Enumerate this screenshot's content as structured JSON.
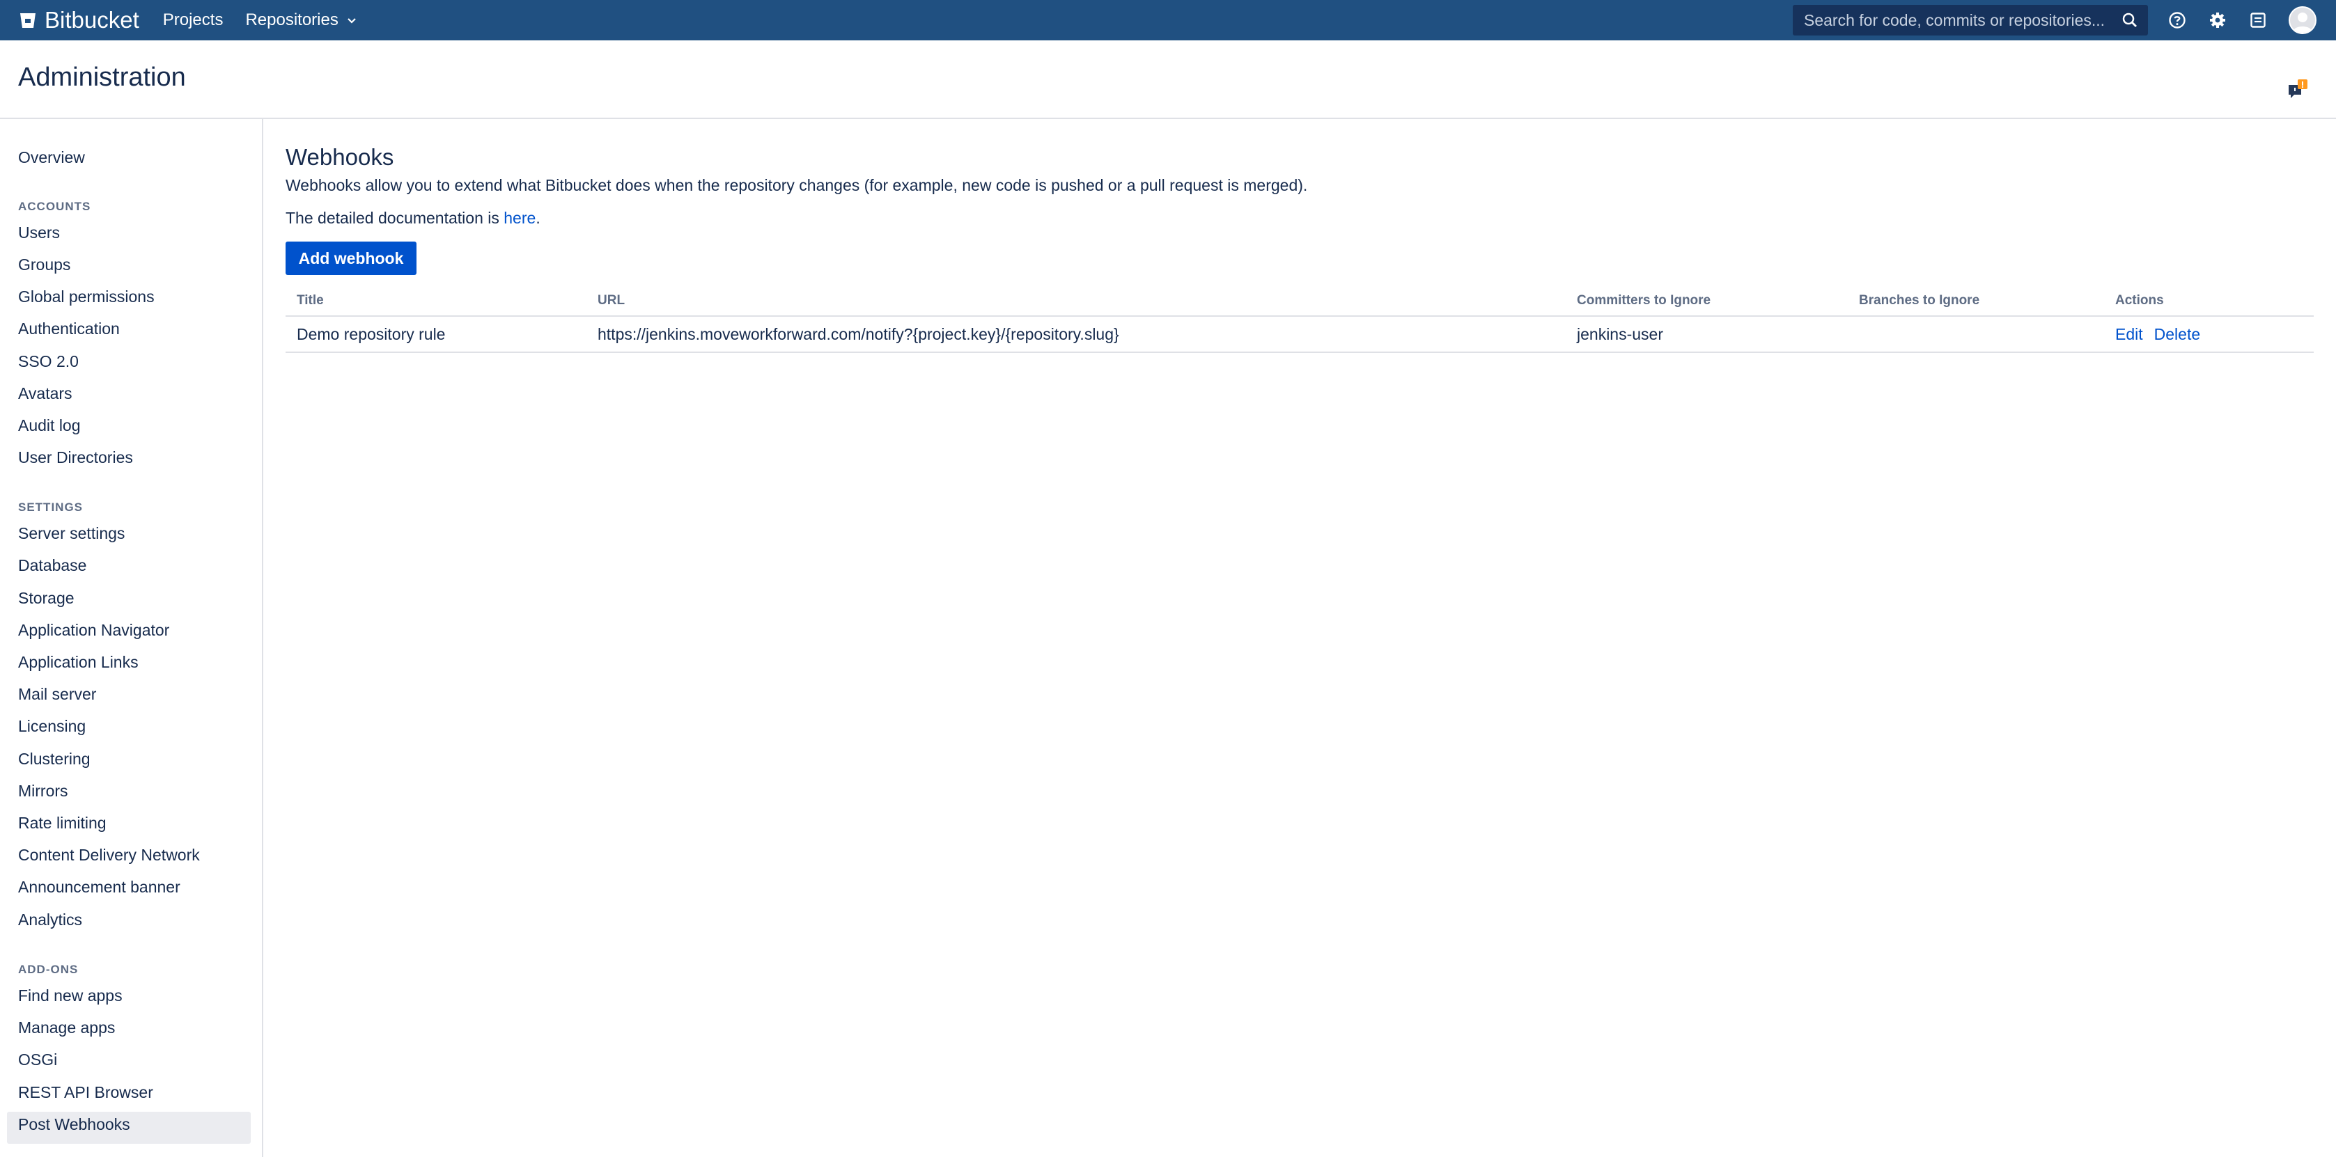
{
  "topnav": {
    "brand": "Bitbucket",
    "projects": "Projects",
    "repositories": "Repositories",
    "search_placeholder": "Search for code, commits or repositories...",
    "colors": {
      "bar": "#205081",
      "search": "#16325c"
    }
  },
  "header": {
    "title": "Administration"
  },
  "sidebar": {
    "overview": "Overview",
    "accounts_heading": "ACCOUNTS",
    "accounts": [
      "Users",
      "Groups",
      "Global permissions",
      "Authentication",
      "SSO 2.0",
      "Avatars",
      "Audit log",
      "User Directories"
    ],
    "settings_heading": "SETTINGS",
    "settings": [
      "Server settings",
      "Database",
      "Storage",
      "Application Navigator",
      "Application Links",
      "Mail server",
      "Licensing",
      "Clustering",
      "Mirrors",
      "Rate limiting",
      "Content Delivery Network",
      "Announcement banner",
      "Analytics"
    ],
    "addons_heading": "ADD-ONS",
    "addons": [
      "Find new apps",
      "Manage apps",
      "OSGi",
      "REST API Browser",
      "Post Webhooks"
    ],
    "active_item": "Post Webhooks"
  },
  "main": {
    "title": "Webhooks",
    "description": "Webhooks allow you to extend what Bitbucket does when the repository changes (for example, new code is pushed or a pull request is merged).",
    "doc_prefix": "The detailed documentation is ",
    "doc_link": "here",
    "doc_suffix": ".",
    "add_button": "Add webhook",
    "table": {
      "columns": [
        "Title",
        "URL",
        "Committers to Ignore",
        "Branches to Ignore",
        "Actions"
      ],
      "rows": [
        {
          "title": "Demo repository rule",
          "url": "https://jenkins.moveworkforward.com/notify?{project.key}/{repository.slug}",
          "committers": "jenkins-user",
          "branches": "",
          "edit": "Edit",
          "delete": "Delete"
        }
      ]
    }
  }
}
